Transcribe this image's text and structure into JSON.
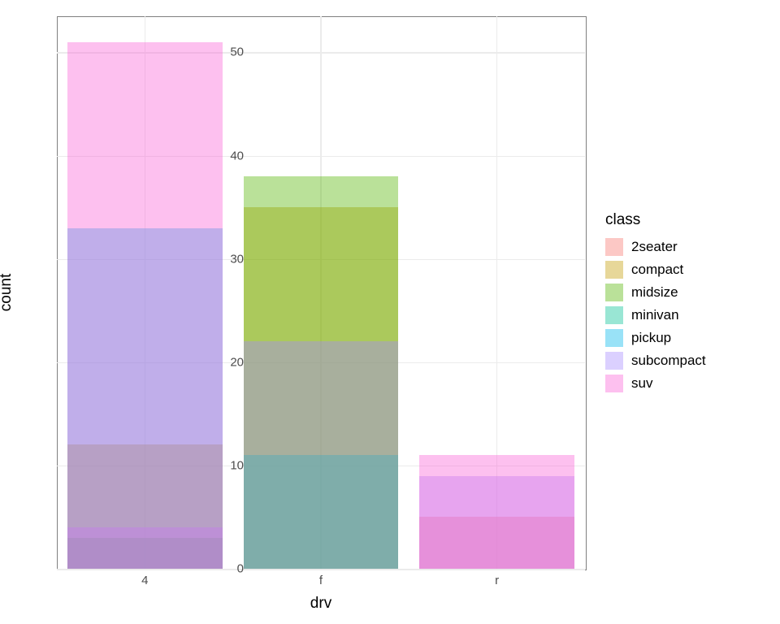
{
  "chart_data": {
    "type": "bar",
    "position": "identity-overlaid",
    "alpha": 0.4,
    "xlabel": "drv",
    "ylabel": "count",
    "categories": [
      "4",
      "f",
      "r"
    ],
    "x_ticks": [
      "4",
      "f",
      "r"
    ],
    "y_ticks": [
      0,
      10,
      20,
      30,
      40,
      50
    ],
    "ylim": [
      0,
      53.5
    ],
    "legend_title": "class",
    "series": [
      {
        "name": "2seater",
        "color": "#F8766D",
        "values": {
          "4": 0,
          "f": 0,
          "r": 5
        }
      },
      {
        "name": "compact",
        "color": "#C49A00",
        "values": {
          "4": 12,
          "f": 35,
          "r": 0
        }
      },
      {
        "name": "midsize",
        "color": "#53B400",
        "values": {
          "4": 3,
          "f": 38,
          "r": 0
        }
      },
      {
        "name": "minivan",
        "color": "#00C094",
        "values": {
          "4": 0,
          "f": 11,
          "r": 0
        }
      },
      {
        "name": "pickup",
        "color": "#00B6EB",
        "values": {
          "4": 33,
          "f": 0,
          "r": 0
        }
      },
      {
        "name": "subcompact",
        "color": "#A58AFF",
        "values": {
          "4": 4,
          "f": 22,
          "r": 9
        }
      },
      {
        "name": "suv",
        "color": "#FB61D7",
        "values": {
          "4": 51,
          "f": 0,
          "r": 11
        }
      }
    ]
  }
}
